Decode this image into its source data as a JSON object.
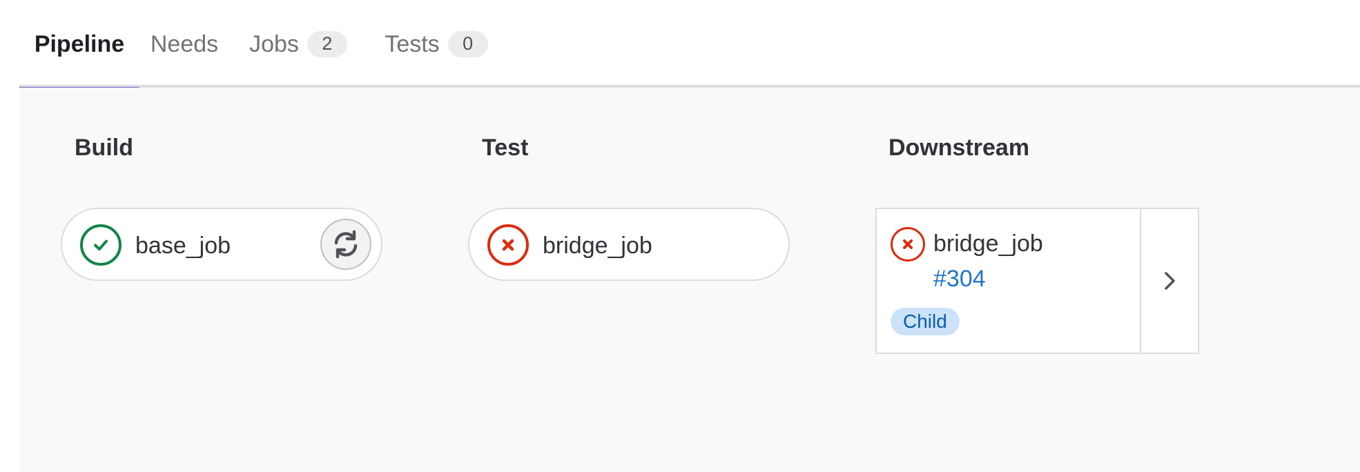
{
  "tabs": [
    {
      "label": "Pipeline",
      "active": true
    },
    {
      "label": "Needs"
    },
    {
      "label": "Jobs",
      "count": "2"
    },
    {
      "label": "Tests",
      "count": "0"
    }
  ],
  "stages": [
    {
      "title": "Build",
      "jobs": [
        {
          "name": "base_job",
          "status": "success",
          "status_icon": "check-circle-icon",
          "action_icon": "retry-icon"
        }
      ]
    },
    {
      "title": "Test",
      "jobs": [
        {
          "name": "bridge_job",
          "status": "failed",
          "status_icon": "x-circle-icon"
        }
      ]
    },
    {
      "title": "Downstream",
      "jobs": [
        {
          "name": "bridge_job",
          "pipeline_id": "#304",
          "relation": "Child",
          "status": "failed",
          "status_icon": "x-circle-icon",
          "expand_icon": "chevron-right-icon"
        }
      ]
    }
  ],
  "colors": {
    "accent": "#6e62c4",
    "success": "#108548",
    "failed": "#dd2b0e",
    "link": "#1f75cb",
    "child_badge_bg": "#cbe2f9"
  }
}
